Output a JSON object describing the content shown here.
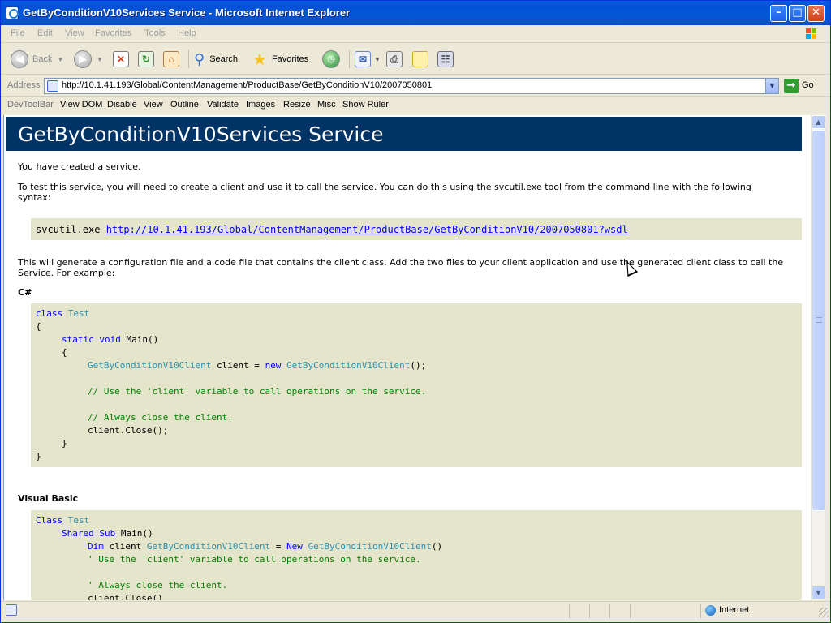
{
  "window": {
    "title": "GetByConditionV10Services Service - Microsoft Internet Explorer",
    "minimize_glyph": "–",
    "maximize_glyph": "□",
    "close_glyph": "✕"
  },
  "menu": [
    "File",
    "Edit",
    "View",
    "Favorites",
    "Tools",
    "Help"
  ],
  "toolbar": {
    "back_label": "Back",
    "search_label": "Search",
    "favorites_label": "Favorites"
  },
  "address": {
    "label": "Address",
    "url": "http://10.1.41.193/Global/ContentManagement/ProductBase/GetByConditionV10/2007050801",
    "go_label": "Go"
  },
  "devtoolbar": [
    "DevToolBar",
    "View DOM",
    "Disable",
    "View",
    "Outline",
    "Validate",
    "Images",
    "Resize",
    "Misc",
    "Show Ruler"
  ],
  "page": {
    "heading": "GetByConditionV10Services Service",
    "intro": "You have created a service.",
    "test_line1": "To test this service, you will need to create a client and use it to call the service. You can do this using the svcutil.exe tool from the command line with the following",
    "test_line2": "syntax:",
    "svcutil_cmd": "svcutil.exe ",
    "svcutil_link": "http://10.1.41.193/Global/ContentManagement/ProductBase/GetByConditionV10/2007050801?wsdl",
    "generate_line1": "This will generate a configuration file and a code file that contains the client class. Add the two files to your client application and use the generated client class to call the",
    "generate_line2": "Service. For example:",
    "csharp_label": "C#",
    "vb_label": "Visual Basic"
  },
  "csharp_code": {
    "l1_kw": "class",
    "l1_ty": "Test",
    "l2": "{",
    "l3_kw": "static void",
    "l3_rest": " Main()",
    "l4": "{",
    "l5_ty1": "GetByConditionV10Client",
    "l5_mid": " client = ",
    "l5_kw": "new",
    "l5_ty2": "GetByConditionV10Client",
    "l5_end": "();",
    "l6_cm": "// Use the 'client' variable to call operations on the service.",
    "l7_cm": "// Always close the client.",
    "l8": "client.Close();",
    "l9": "}",
    "l10": "}"
  },
  "vb_code": {
    "l1_kw": "Class",
    "l1_ty": "Test",
    "l2_kw": "Shared Sub",
    "l2_rest": " Main()",
    "l3_kw": "Dim",
    "l3_mid": " client ",
    "l3_ty1": "GetByConditionV10Client",
    "l3_eq": " = ",
    "l3_kw2": "New",
    "l3_ty2": "GetByConditionV10Client",
    "l3_end": "()",
    "l4_cm": "' Use the 'client' variable to call operations on the service.",
    "l5_cm": "' Always close the client.",
    "l6": "client.Close()"
  },
  "status": {
    "zone": "Internet"
  },
  "colors": {
    "heading_band": "#003366",
    "code_background": "#e5e5cc",
    "keyword": "#0000ff",
    "type": "#2b91af",
    "comment": "#008000"
  },
  "icons": [
    "ie-app-icon",
    "windows-logo-icon",
    "back-icon",
    "forward-icon",
    "stop-icon",
    "refresh-icon",
    "home-icon",
    "search-icon",
    "favorites-star-icon",
    "history-icon",
    "mail-icon",
    "print-icon",
    "edit-icon",
    "messenger-icon",
    "page-icon",
    "go-arrow-icon",
    "globe-icon",
    "mouse-cursor-icon"
  ]
}
